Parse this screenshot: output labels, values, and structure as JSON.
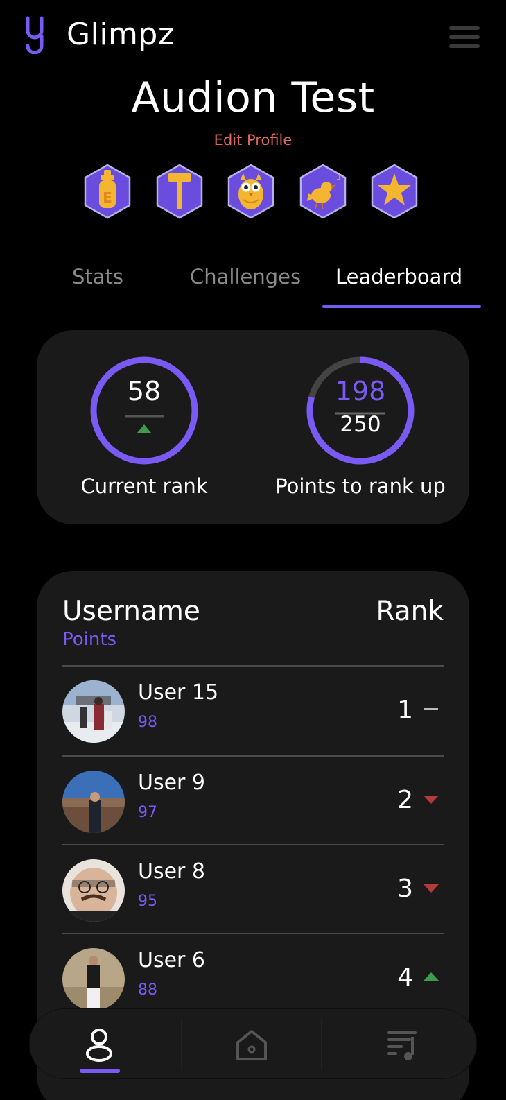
{
  "app": {
    "title": "Glimpz"
  },
  "profile": {
    "name": "Audion Test",
    "edit_label": "Edit Profile"
  },
  "badges": [
    {
      "name": "baby-bottle-badge"
    },
    {
      "name": "gavel-badge"
    },
    {
      "name": "owl-badge"
    },
    {
      "name": "singing-bird-badge"
    },
    {
      "name": "star-badge"
    }
  ],
  "tabs": [
    {
      "label": "Stats",
      "active": false
    },
    {
      "label": "Challenges",
      "active": false
    },
    {
      "label": "Leaderboard",
      "active": true
    }
  ],
  "rank_summary": {
    "current_rank": {
      "value": "58",
      "trend": "up",
      "caption": "Current rank"
    },
    "points_to_rank_up": {
      "current": "198",
      "target": "250",
      "progress": 0.792,
      "caption": "Points to rank up"
    }
  },
  "leaderboard": {
    "header_username": "Username",
    "header_points": "Points",
    "header_rank": "Rank",
    "rows": [
      {
        "username": "User 15",
        "points": "98",
        "rank": "1",
        "trend": "same"
      },
      {
        "username": "User 9",
        "points": "97",
        "rank": "2",
        "trend": "down"
      },
      {
        "username": "User 8",
        "points": "95",
        "rank": "3",
        "trend": "down"
      },
      {
        "username": "User 6",
        "points": "88",
        "rank": "4",
        "trend": "up"
      }
    ]
  },
  "nav": [
    {
      "name": "profile-nav",
      "icon": "user-icon",
      "active": true
    },
    {
      "name": "home-nav",
      "icon": "home-icon",
      "active": false
    },
    {
      "name": "playlist-nav",
      "icon": "playlist-icon",
      "active": false
    }
  ],
  "colors": {
    "accent": "#7a5af5",
    "edit_link": "#e0685f",
    "trend_up": "#3f9a4e",
    "trend_down": "#b23b3b",
    "card": "#1a1a1a"
  }
}
